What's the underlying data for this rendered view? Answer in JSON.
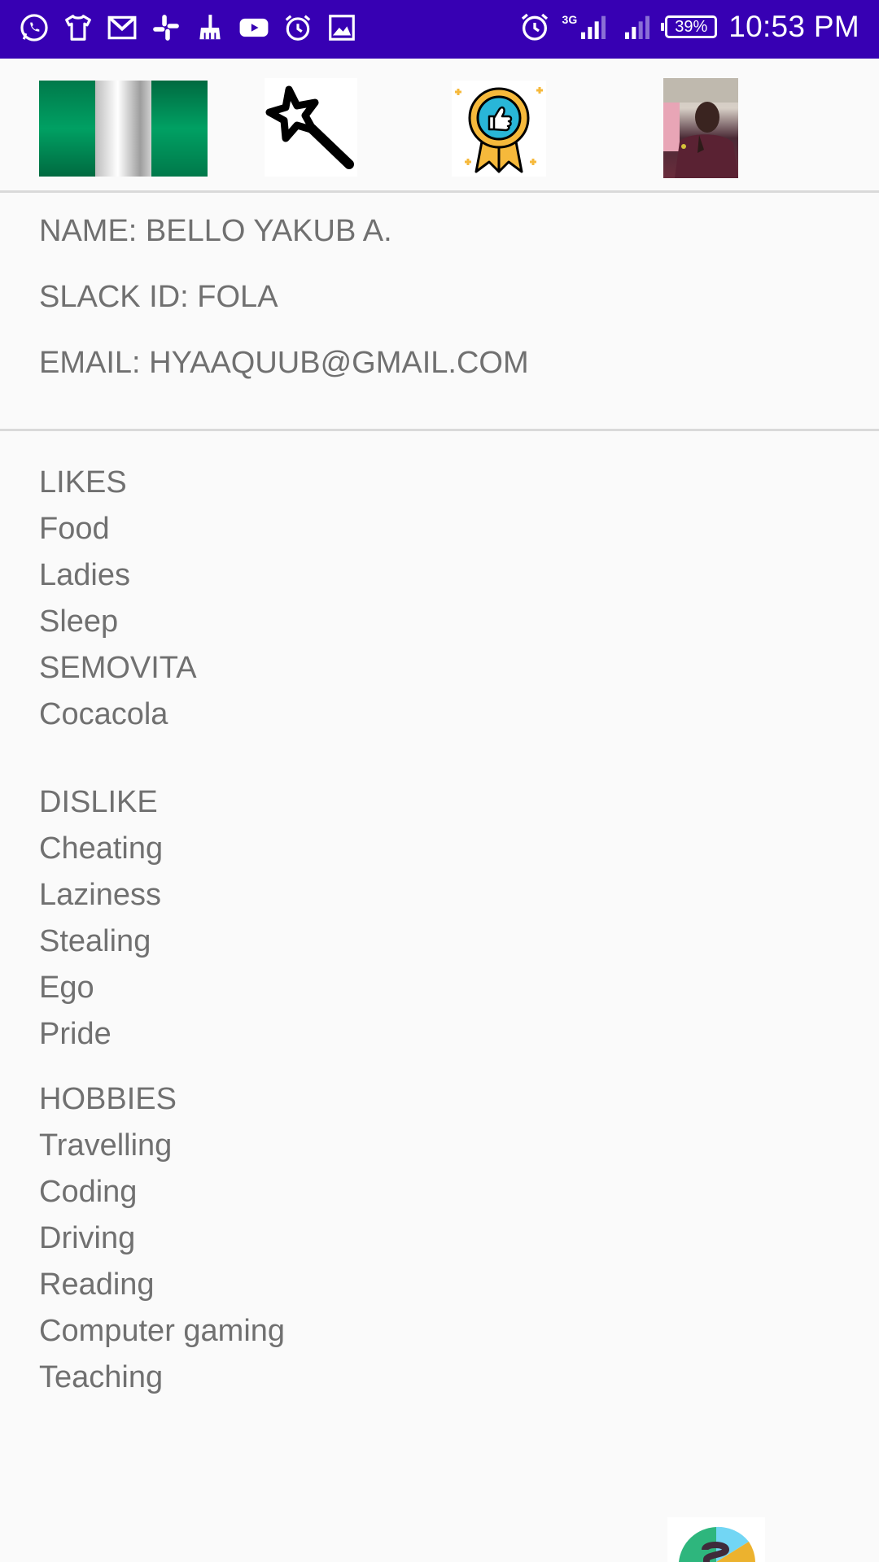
{
  "status_bar": {
    "time": "10:53 PM",
    "battery": "39%",
    "network": "3G",
    "left_icons": [
      "whatsapp-icon",
      "shirt-icon",
      "gmail-icon",
      "slack-icon",
      "broom-icon",
      "youtube-icon",
      "alarm-icon",
      "image-icon"
    ],
    "right_icons": [
      "alarm-icon",
      "signal-icon",
      "signal-icon",
      "battery-icon"
    ]
  },
  "header_images": [
    {
      "name": "nigeria-flag-image",
      "colors": [
        "#008751",
        "#ffffff",
        "#008751"
      ]
    },
    {
      "name": "magic-wand-image"
    },
    {
      "name": "thumbs-up-badge-image",
      "colors": [
        "#f6b93b",
        "#29b6d8"
      ]
    },
    {
      "name": "profile-photo-image"
    }
  ],
  "profile": {
    "name": "NAME: BELLO YAKUB A.",
    "slack_id": "SLACK ID: FOLA",
    "email": "EMAIL: HYAAQUUB@GMAIL.COM"
  },
  "likes": {
    "title": "LIKES",
    "items": [
      "Food",
      "Ladies",
      "Sleep",
      "SEMOVITA",
      "Cocacola"
    ]
  },
  "dislikes": {
    "title": "DISLIKE",
    "items": [
      "Cheating",
      "Laziness",
      "Stealing",
      "Ego",
      "Pride"
    ]
  },
  "hobbies": {
    "title": "HOBBIES",
    "items": [
      "Travelling",
      "Coding",
      "Driving",
      "Reading",
      "Computer gaming",
      "Teaching"
    ]
  },
  "colors": {
    "status_bar": "#3700b3",
    "text": "#707070",
    "background": "#fafafa",
    "divider": "#d9d9d9"
  }
}
